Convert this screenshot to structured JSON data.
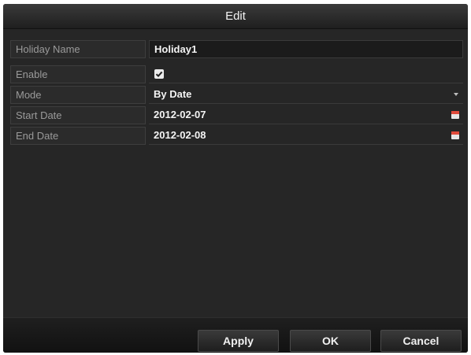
{
  "dialog": {
    "title": "Edit"
  },
  "form": {
    "holiday_name": {
      "label": "Holiday Name",
      "value": "Holiday1"
    },
    "enable": {
      "label": "Enable",
      "checked": true
    },
    "mode": {
      "label": "Mode",
      "value": "By Date"
    },
    "start_date": {
      "label": "Start Date",
      "value": "2012-02-07"
    },
    "end_date": {
      "label": "End Date",
      "value": "2012-02-08"
    }
  },
  "buttons": {
    "apply": "Apply",
    "ok": "OK",
    "cancel": "Cancel"
  },
  "icons": {
    "checkbox": "checkmark-icon",
    "mode_dropdown": "chevron-down-icon",
    "date_picker": "calendar-icon"
  },
  "colors": {
    "background": "#262626",
    "calendar_accent": "#e04b3c"
  }
}
